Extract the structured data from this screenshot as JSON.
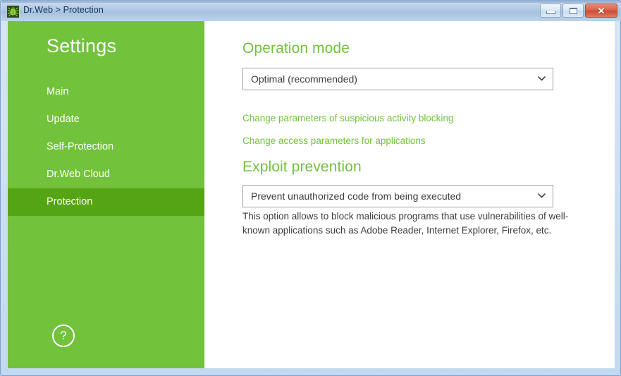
{
  "window": {
    "title": "Dr.Web > Protection",
    "app_icon": "drweb-spider-icon",
    "controls": {
      "minimize_label": "Minimize",
      "maximize_label": "Maximize",
      "close_label": "Close"
    }
  },
  "sidebar": {
    "title": "Settings",
    "items": [
      {
        "label": "Main",
        "active": false
      },
      {
        "label": "Update",
        "active": false
      },
      {
        "label": "Self-Protection",
        "active": false
      },
      {
        "label": "Dr.Web Cloud",
        "active": false
      },
      {
        "label": "Protection",
        "active": true
      }
    ],
    "help_glyph": "?",
    "colors": {
      "background": "#72c23c",
      "active": "#55a413",
      "text": "#ffffff"
    }
  },
  "main": {
    "sections": [
      {
        "heading": "Operation mode",
        "dropdown": {
          "value": "Optimal (recommended)",
          "icon": "chevron-down-icon"
        },
        "links": [
          "Change parameters of suspicious activity blocking",
          "Change access parameters for applications"
        ]
      },
      {
        "heading": "Exploit prevention",
        "dropdown": {
          "value": "Prevent unauthorized code from being executed",
          "icon": "chevron-down-icon"
        },
        "description": "This option allows to block malicious programs that use vulnerabilities of well-known applications such as Adobe Reader, Internet Explorer, Firefox, etc."
      }
    ],
    "colors": {
      "heading": "#72c23c",
      "link": "#72c23c",
      "text": "#3c3c3c",
      "field_border": "#9e9e9e"
    }
  }
}
